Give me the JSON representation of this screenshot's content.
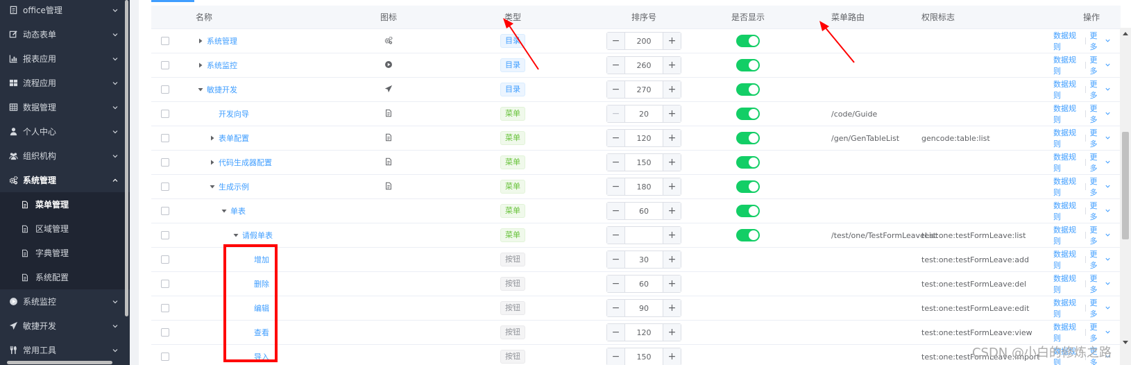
{
  "sidebar": {
    "items": [
      {
        "label": "office管理",
        "icon": "file-icon"
      },
      {
        "label": "动态表单",
        "icon": "edit-icon"
      },
      {
        "label": "报表应用",
        "icon": "bar-chart-icon"
      },
      {
        "label": "流程应用",
        "icon": "grid-icon"
      },
      {
        "label": "数据管理",
        "icon": "table-icon"
      },
      {
        "label": "个人中心",
        "icon": "user-icon"
      },
      {
        "label": "组织机构",
        "icon": "users-icon"
      },
      {
        "label": "系统管理",
        "icon": "gears-icon"
      }
    ],
    "sub_items": [
      {
        "label": "菜单管理"
      },
      {
        "label": "区域管理"
      },
      {
        "label": "字典管理"
      },
      {
        "label": "系统配置"
      }
    ],
    "after_items": [
      {
        "label": "系统监控",
        "icon": "play-circle-icon"
      },
      {
        "label": "敏捷开发",
        "icon": "paper-plane-icon"
      },
      {
        "label": "常用工具",
        "icon": "tools-icon"
      }
    ]
  },
  "table": {
    "headers": {
      "name": "名称",
      "icon": "图标",
      "type": "类型",
      "sort": "排序号",
      "show": "是否显示",
      "route": "菜单路由",
      "perm": "权限标志",
      "ops": "操作"
    },
    "rows": [
      {
        "name": "系统管理",
        "indent": 0,
        "tree": "collapsed",
        "icon": "gears-icon",
        "type": "目录",
        "type_kind": "dir",
        "sort": "200",
        "show": true,
        "route": "",
        "perm": ""
      },
      {
        "name": "系统监控",
        "indent": 0,
        "tree": "collapsed",
        "icon": "play-circle-icon",
        "type": "目录",
        "type_kind": "dir",
        "sort": "260",
        "show": true,
        "route": "",
        "perm": ""
      },
      {
        "name": "敏捷开发",
        "indent": 0,
        "tree": "expanded",
        "icon": "paper-plane-icon",
        "type": "目录",
        "type_kind": "dir",
        "sort": "270",
        "show": true,
        "route": "",
        "perm": ""
      },
      {
        "name": "开发向导",
        "indent": 1,
        "tree": "none",
        "icon": "document-icon",
        "type": "菜单",
        "type_kind": "menu",
        "sort": "20",
        "show": true,
        "route": "/code/Guide",
        "perm": ""
      },
      {
        "name": "表单配置",
        "indent": 1,
        "tree": "collapsed",
        "icon": "document-icon",
        "type": "菜单",
        "type_kind": "menu",
        "sort": "120",
        "show": true,
        "route": "/gen/GenTableList",
        "perm": "gencode:table:list"
      },
      {
        "name": "代码生成器配置",
        "indent": 1,
        "tree": "collapsed",
        "icon": "document-icon",
        "type": "菜单",
        "type_kind": "menu",
        "sort": "150",
        "show": true,
        "route": "",
        "perm": ""
      },
      {
        "name": "生成示例",
        "indent": 1,
        "tree": "expanded",
        "icon": "document-icon",
        "type": "菜单",
        "type_kind": "menu",
        "sort": "180",
        "show": true,
        "route": "",
        "perm": ""
      },
      {
        "name": "单表",
        "indent": 2,
        "tree": "expanded",
        "icon": "",
        "type": "菜单",
        "type_kind": "menu",
        "sort": "60",
        "show": true,
        "route": "",
        "perm": ""
      },
      {
        "name": "请假单表",
        "indent": 3,
        "tree": "expanded",
        "icon": "",
        "type": "菜单",
        "type_kind": "menu",
        "sort": "",
        "show": true,
        "route": "/test/one/TestFormLeaveList",
        "perm": "test:one:testFormLeave:list"
      },
      {
        "name": "增加",
        "indent": 4,
        "tree": "none",
        "icon": "",
        "type": "按钮",
        "type_kind": "btn",
        "sort": "30",
        "show": false,
        "route": "",
        "perm": "test:one:testFormLeave:add"
      },
      {
        "name": "删除",
        "indent": 4,
        "tree": "none",
        "icon": "",
        "type": "按钮",
        "type_kind": "btn",
        "sort": "60",
        "show": false,
        "route": "",
        "perm": "test:one:testFormLeave:del"
      },
      {
        "name": "编辑",
        "indent": 4,
        "tree": "none",
        "icon": "",
        "type": "按钮",
        "type_kind": "btn",
        "sort": "90",
        "show": false,
        "route": "",
        "perm": "test:one:testFormLeave:edit"
      },
      {
        "name": "查看",
        "indent": 4,
        "tree": "none",
        "icon": "",
        "type": "按钮",
        "type_kind": "btn",
        "sort": "120",
        "show": false,
        "route": "",
        "perm": "test:one:testFormLeave:view"
      },
      {
        "name": "导入",
        "indent": 4,
        "tree": "none",
        "icon": "",
        "type": "按钮",
        "type_kind": "btn",
        "sort": "150",
        "show": false,
        "route": "",
        "perm": "test:one:testFormLeave:import"
      }
    ],
    "op_rule": "数据规则",
    "op_more": "更多",
    "stepper_minus": "−",
    "stepper_plus": "+"
  },
  "watermark": "CSDN @小白的修炼之路",
  "colors": {
    "sidebar_bg": "#28303f",
    "accent": "#409eff",
    "switch_on": "#13ce66",
    "annotation": "#ff0000"
  }
}
